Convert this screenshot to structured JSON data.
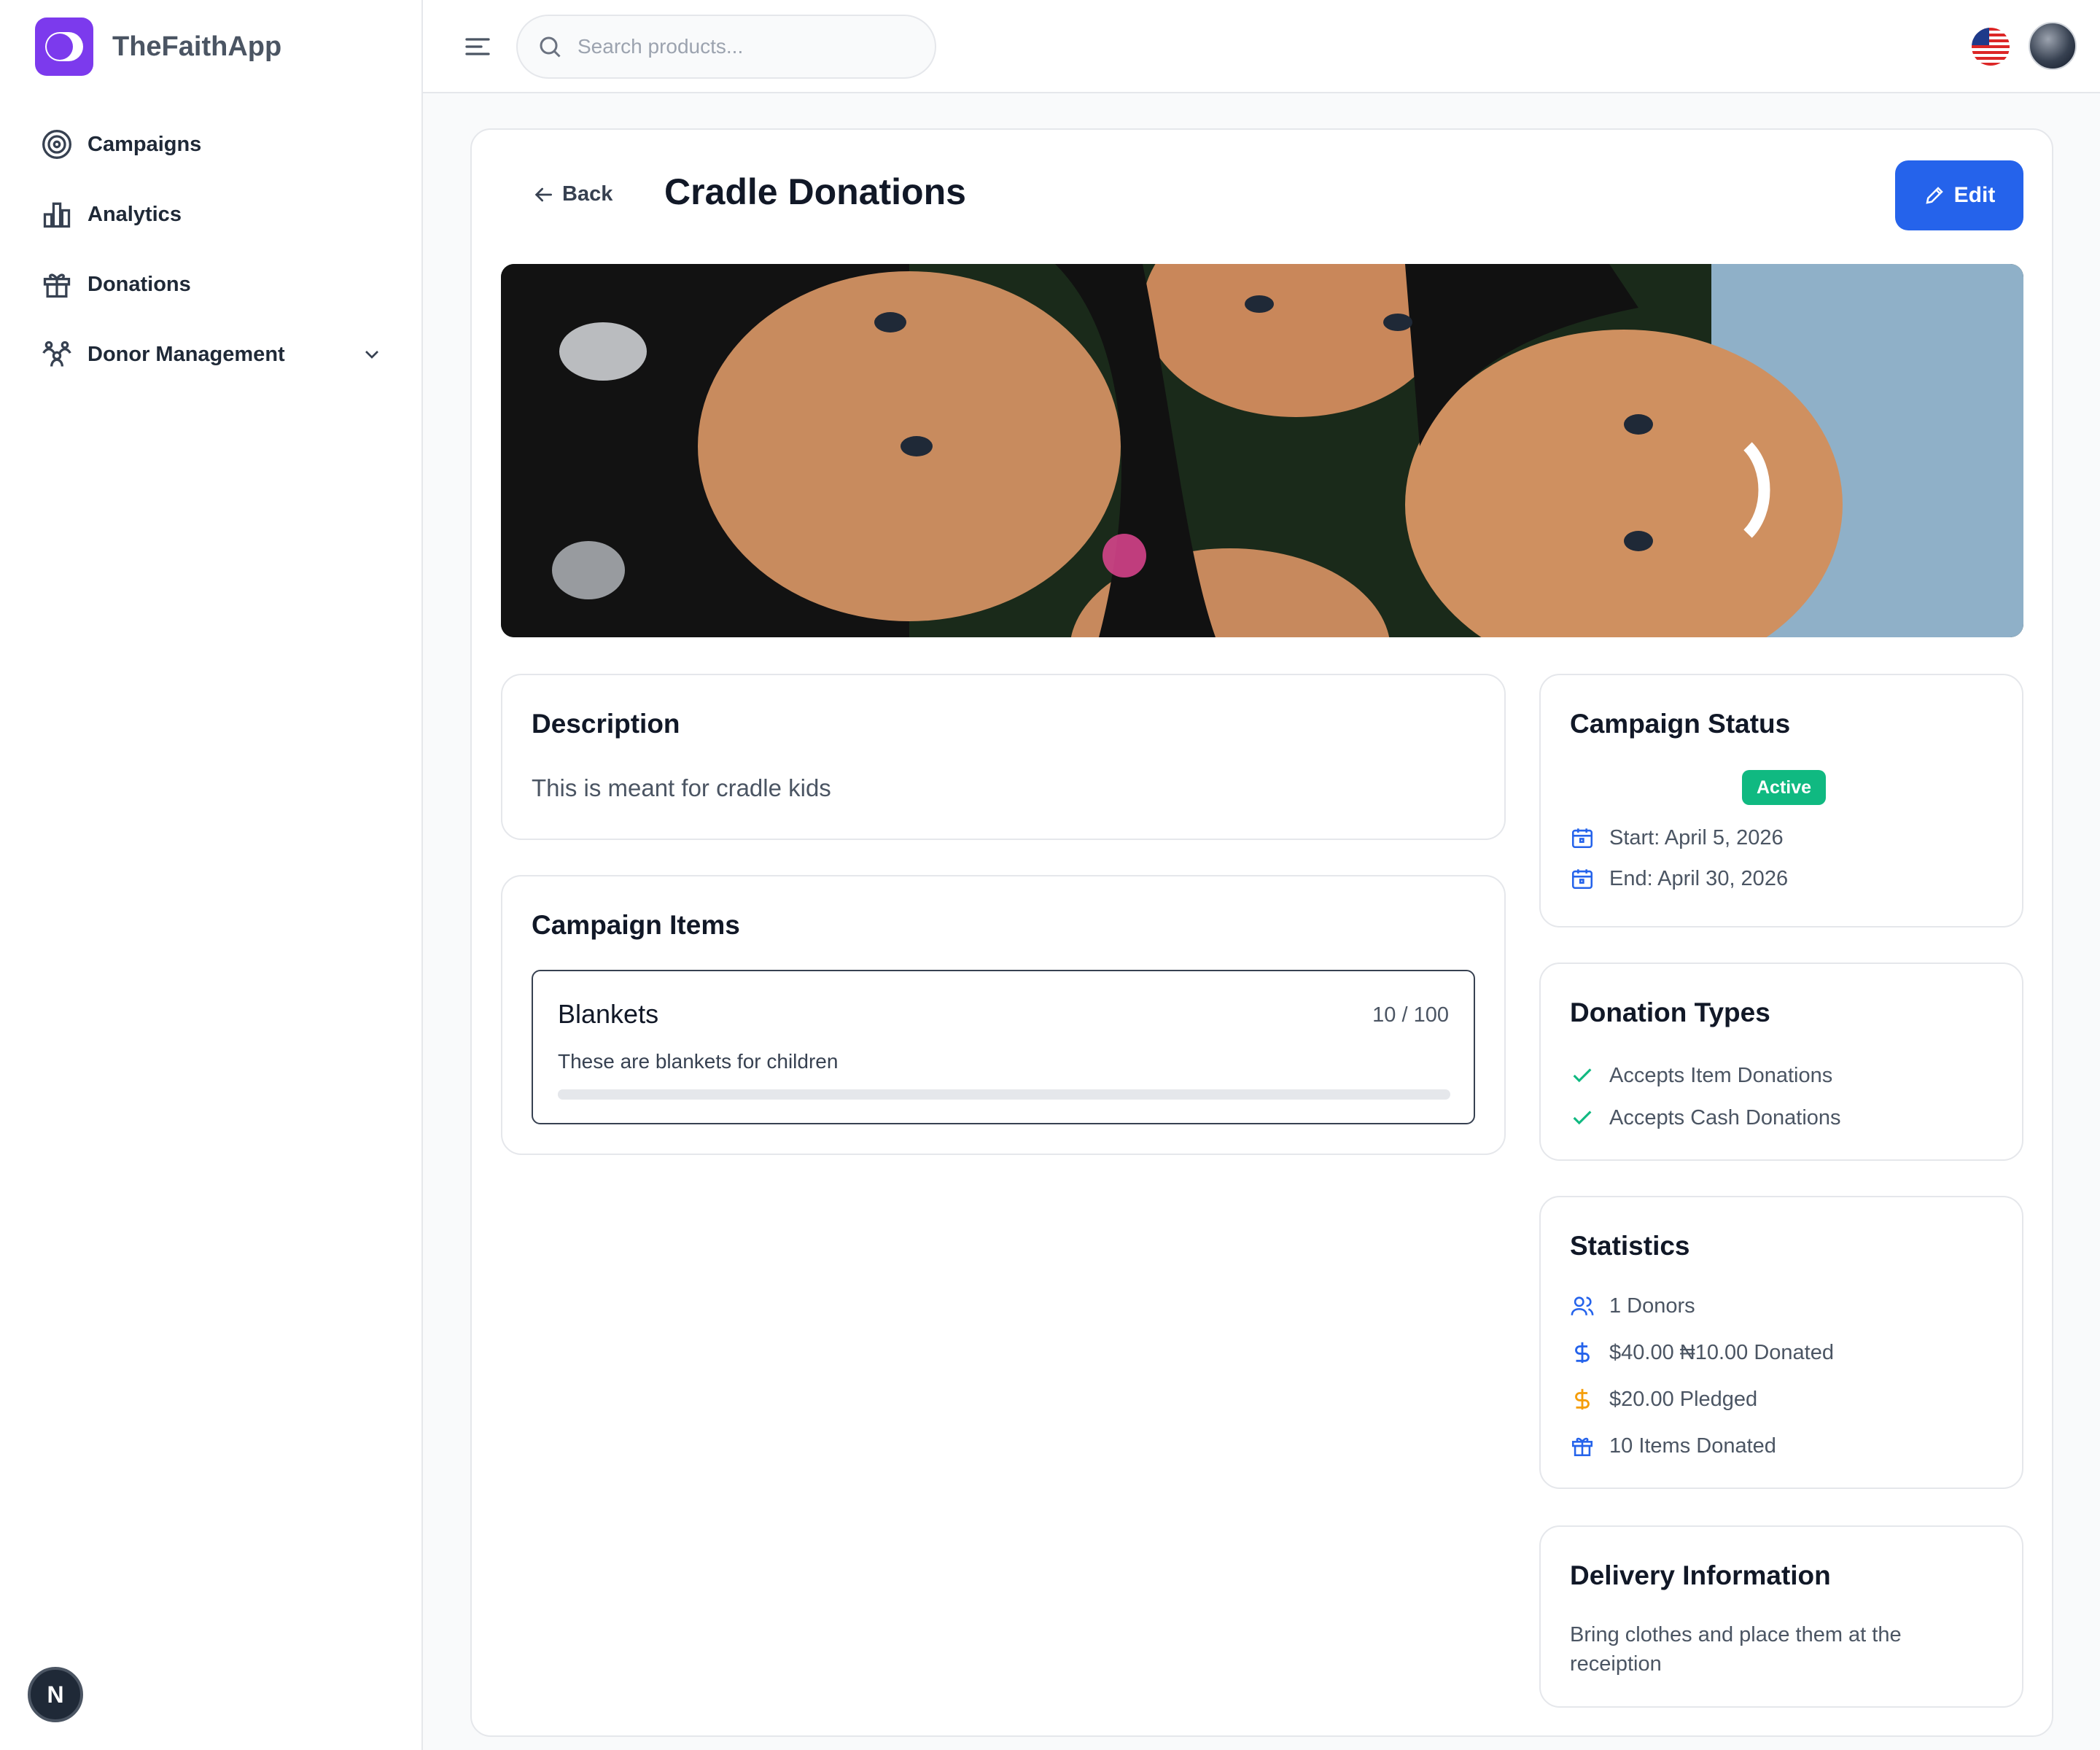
{
  "app": {
    "name": "TheFaithApp",
    "brand_color": "#7c3aed"
  },
  "sidebar": {
    "items": [
      {
        "label": "Campaigns",
        "icon": "target-icon"
      },
      {
        "label": "Analytics",
        "icon": "bar-chart-icon"
      },
      {
        "label": "Donations",
        "icon": "gift-icon"
      },
      {
        "label": "Donor Management",
        "icon": "users-icon",
        "expandable": true
      }
    ],
    "footer_badge": "N"
  },
  "topbar": {
    "search_placeholder": "Search products...",
    "language": "us-flag-icon"
  },
  "page": {
    "back_label": "Back",
    "title": "Cradle Donations",
    "edit_label": "Edit",
    "accent_color": "#2563eb"
  },
  "description": {
    "heading": "Description",
    "text": "This is meant for cradle kids"
  },
  "campaign_items": {
    "heading": "Campaign Items",
    "items": [
      {
        "name": "Blankets",
        "count": "10 / 100",
        "description": "These are blankets for children",
        "progress": 0.1
      }
    ]
  },
  "status": {
    "heading": "Campaign Status",
    "badge": "Active",
    "badge_color": "#10b981",
    "start": "Start: April 5, 2026",
    "end": "End: April 30, 2026"
  },
  "donation_types": {
    "heading": "Donation Types",
    "items": [
      "Accepts Item Donations",
      "Accepts Cash Donations"
    ]
  },
  "statistics": {
    "heading": "Statistics",
    "donors": "1 Donors",
    "donated": "$40.00 ₦10.00 Donated",
    "pledged": "$20.00 Pledged",
    "items_donated": "10 Items Donated"
  },
  "delivery": {
    "heading": "Delivery Information",
    "text": "Bring clothes and place them at the receiption"
  }
}
